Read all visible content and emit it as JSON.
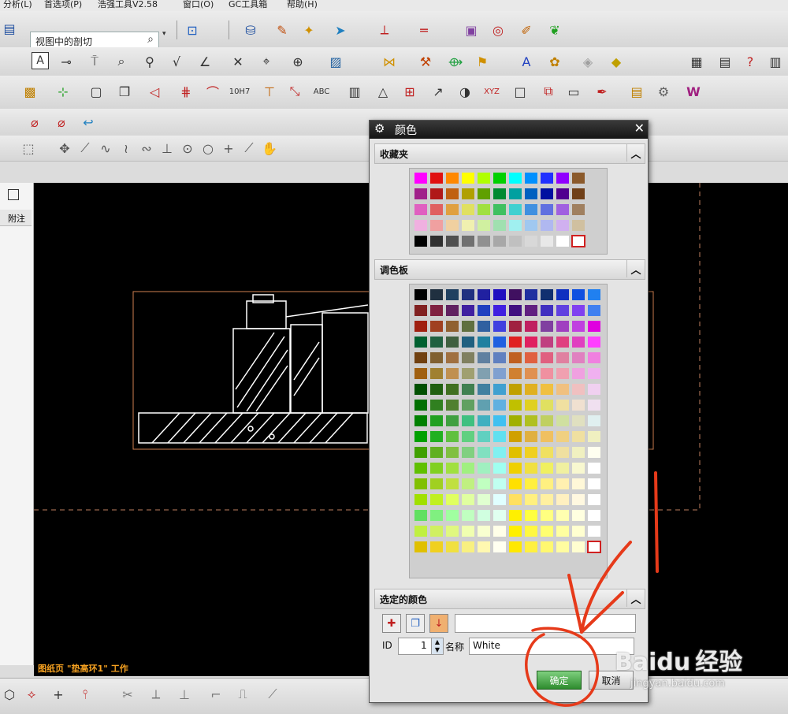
{
  "menu": {
    "items": [
      "分析(L)",
      "首选项(P)",
      "浩强工具V2.58",
      "窗口(O)",
      "GC工具箱",
      "帮助(H)"
    ]
  },
  "toolbar": {
    "view_combo_value": "视图中的剖切"
  },
  "canvas": {
    "status_text": "图纸页 \"垫高环1\" 工作"
  },
  "left_panel": {
    "column_header": "附注"
  },
  "dialog": {
    "title": "颜色",
    "favorites_label": "收藏夹",
    "palette_label": "调色板",
    "selected_label": "选定的颜色",
    "id_label": "ID",
    "id_value": "1",
    "name_label": "名称",
    "name_value": "White",
    "ok_label": "确定",
    "cancel_label": "取消",
    "favorites_colors": [
      [
        "#ff00ff",
        "#e01010",
        "#ff8800",
        "#ffff00",
        "#b0ff00",
        "#00d000",
        "#00ffff",
        "#0090ff",
        "#2030ff",
        "#9000ff",
        "#8b5a2b"
      ],
      [
        "#a0208a",
        "#b01818",
        "#c06010",
        "#b0a000",
        "#60a000",
        "#008a30",
        "#00a0a0",
        "#0060c0",
        "#0010a0",
        "#500090",
        "#704018"
      ],
      [
        "#e060c0",
        "#e06060",
        "#e0a040",
        "#e0e060",
        "#a0e040",
        "#40c060",
        "#40d0d0",
        "#4090e0",
        "#6070e0",
        "#a060e0",
        "#a08060"
      ],
      [
        "#f0b0e0",
        "#f0a0a0",
        "#f0d0a0",
        "#f0f0b0",
        "#d0f0a0",
        "#a0e0b0",
        "#a0f0f0",
        "#a0c8f0",
        "#b0b8f0",
        "#d0b0f0",
        "#d0c0a0"
      ],
      [
        "#000000",
        "#303030",
        "#505050",
        "#707070",
        "#909090",
        "#a8a8a8",
        "#c0c0c0",
        "#d8d8d8",
        "#e8e8e8",
        "#ffffff",
        "#ffffff"
      ]
    ],
    "palette_colors": [
      [
        "#000000",
        "#203040",
        "#204060",
        "#203080",
        "#2020a0",
        "#2010c0",
        "#401060",
        "#2030a0",
        "#103070",
        "#1030c0",
        "#1050e0",
        "#2080f0"
      ],
      [
        "#802020",
        "#802040",
        "#602060",
        "#4020a0",
        "#2040c0",
        "#4020e0",
        "#401080",
        "#602080",
        "#4030c0",
        "#6040e0",
        "#8040f0",
        "#4080f0"
      ],
      [
        "#a02010",
        "#a04020",
        "#906030",
        "#607040",
        "#3060a0",
        "#4040e0",
        "#a02040",
        "#c02060",
        "#8040a0",
        "#a040c0",
        "#c040e0",
        "#e000e0"
      ],
      [
        "#006030",
        "#206040",
        "#406040",
        "#206080",
        "#2080a0",
        "#2060e0",
        "#e02020",
        "#e02060",
        "#c04080",
        "#e04080",
        "#e040c0",
        "#ff40ff"
      ],
      [
        "#704010",
        "#806030",
        "#a07040",
        "#808060",
        "#6080a0",
        "#6080c0",
        "#c06020",
        "#e06040",
        "#e06080",
        "#e080a0",
        "#e080c0",
        "#f080e0"
      ],
      [
        "#a06010",
        "#a08030",
        "#c09050",
        "#a0a070",
        "#80a0b0",
        "#80a0d0",
        "#d08030",
        "#e09050",
        "#f090a0",
        "#f0a0b0",
        "#f0a0e0",
        "#f0b0f0"
      ],
      [
        "#005000",
        "#206010",
        "#407020",
        "#408050",
        "#4080a0",
        "#40a0d0",
        "#c0a000",
        "#e0b020",
        "#f0c040",
        "#f0c080",
        "#f0c0c0",
        "#f0d0f0"
      ],
      [
        "#007000",
        "#308020",
        "#508030",
        "#60a060",
        "#60a0b0",
        "#60b0e0",
        "#c0c000",
        "#e0d020",
        "#e0e060",
        "#f0e0a0",
        "#f0e0d0",
        "#f0e0f0"
      ],
      [
        "#008000",
        "#20a020",
        "#40a040",
        "#40c080",
        "#40b0c0",
        "#40c0f0",
        "#a0b000",
        "#b0c020",
        "#c0d060",
        "#d0e0a0",
        "#e0e0c0",
        "#e0f0f0"
      ],
      [
        "#00a000",
        "#20b020",
        "#60c040",
        "#60d080",
        "#60d0c0",
        "#60e0f0",
        "#d0a000",
        "#e0b040",
        "#f0c060",
        "#f0d080",
        "#f0e0a0",
        "#f0f0c0"
      ],
      [
        "#40a000",
        "#60b020",
        "#80c040",
        "#80d080",
        "#80e0c0",
        "#80f0f0",
        "#e0c000",
        "#f0d020",
        "#f0e060",
        "#f0e0a0",
        "#f0f0c0",
        "#fffff0"
      ],
      [
        "#60c000",
        "#80d020",
        "#a0e040",
        "#a0f080",
        "#a0f0c0",
        "#a0fff0",
        "#f0d000",
        "#f0e040",
        "#f0f060",
        "#f0f0a0",
        "#f8f8d0",
        "#ffffff"
      ],
      [
        "#80c000",
        "#a0d020",
        "#c0e040",
        "#c0f080",
        "#c0ffc0",
        "#c0fff0",
        "#ffe000",
        "#fff040",
        "#fff080",
        "#fff0b0",
        "#fff8d8",
        "#ffffff"
      ],
      [
        "#a0e000",
        "#c0f020",
        "#e0ff60",
        "#e0ffa0",
        "#e0ffd0",
        "#e0ffff",
        "#ffe060",
        "#fff080",
        "#fff0a0",
        "#fff0c0",
        "#fff8e0",
        "#ffffff"
      ],
      [
        "#60e060",
        "#80f080",
        "#a0ffa0",
        "#c0ffc0",
        "#d0ffe0",
        "#e0fff0",
        "#fff000",
        "#ffff40",
        "#ffff80",
        "#ffffb0",
        "#ffffe0",
        "#ffffff"
      ],
      [
        "#c0f040",
        "#d0f060",
        "#e0f880",
        "#f0ffb0",
        "#f8ffd0",
        "#ffffe8",
        "#fff000",
        "#fff840",
        "#ffff70",
        "#ffffa0",
        "#ffffd0",
        "#ffffff"
      ],
      [
        "#e0c000",
        "#f0d020",
        "#f0e040",
        "#f8f080",
        "#fff8b0",
        "#fffff0",
        "#ffe800",
        "#fff040",
        "#fff870",
        "#fffca0",
        "#fffed0",
        "#ffffff"
      ]
    ],
    "colors": {
      "title_bg": "#1f1f1f",
      "ok_bg": "#2e8c2e",
      "selection_border": "#d02020"
    }
  },
  "annotations": {
    "marker_color": "#e63a1a"
  },
  "watermark": {
    "brand": "Baidu",
    "brand_cn": "经验",
    "url": "jingyan.baidu.com"
  }
}
